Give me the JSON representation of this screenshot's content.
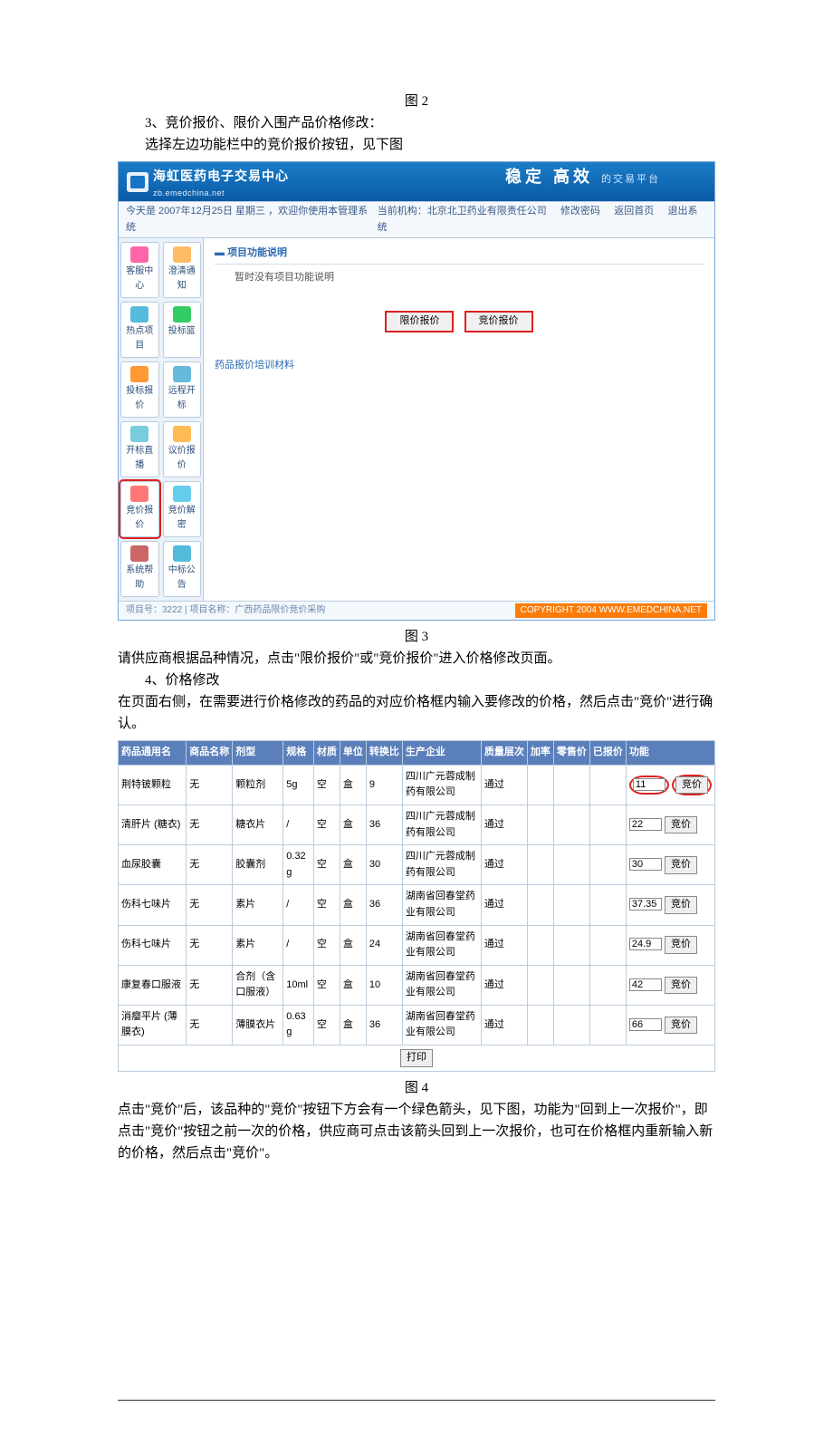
{
  "figs": {
    "f2": "图 2",
    "f3": "图 3",
    "f4": "图 4"
  },
  "text": {
    "sec3": "3、竞价报价、限价入围产品价格修改：",
    "sec3b": "选择左边功能栏中的竞价报价按钮，见下图",
    "between": "请供应商根据品种情况，点击\"限价报价\"或\"竞价报价\"进入价格修改页面。",
    "sec4": "4、价格修改",
    "sec4a": "在页面右侧，在需要进行价格修改的药品的对应价格框内输入要修改的价格，然后点击\"竞价\"进行确认。",
    "after": "点击\"竞价\"后，该品种的\"竞价\"按钮下方会有一个绿色箭头，见下图，功能为\"回到上一次报价\"，即点击\"竞价\"按钮之前一次的价格，供应商可点击该箭头回到上一次报价，也可在价格框内重新输入新的价格，然后点击\"竞价\"。"
  },
  "app": {
    "brand": "海虹医药电子交易中心",
    "brand_sub": "zb.emedchina.net",
    "banner": "稳定 高效",
    "banner_sub": "的交易平台",
    "date_line": "今天是 2007年12月25日 星期三 ，欢迎你使用本管理系统",
    "org": "当前机构：北京北卫药业有限责任公司",
    "links": {
      "pwd": "修改密码",
      "home": "返回首页",
      "logout": "退出系统"
    },
    "sidebar": [
      "客服中心",
      "澄清通知",
      "热点项目",
      "投标篮",
      "投标报价",
      "远程开标",
      "开标直播",
      "议价报价",
      "竞价报价",
      "竞价解密",
      "系统帮助",
      "中标公告"
    ],
    "panel": {
      "head": "项目功能说明",
      "empty": "暂时没有项目功能说明",
      "btn_limit": "限价报价",
      "btn_bid": "竞价报价",
      "link": "药品报价培训材料"
    },
    "footer": {
      "l": "项目号：3222 | 项目名称：广西药品限价竞价采购",
      "r": "COPYRIGHT 2004 WWW.EMEDCHINA.NET"
    }
  },
  "table": {
    "headers": [
      "药品通用名",
      "商品名称",
      "剂型",
      "规格",
      "材质",
      "单位",
      "转换比",
      "生产企业",
      "质量层次",
      "加率",
      "零售价",
      "已报价",
      "功能"
    ],
    "rows": [
      {
        "c": [
          "荆特铍颗粒",
          "无",
          "颗粒剂",
          "5g",
          "空",
          "盒",
          "9",
          "四川广元蓉成制药有限公司",
          "通过",
          "",
          "",
          ""
        ],
        "price": "11"
      },
      {
        "c": [
          "清肝片 (糖衣)",
          "无",
          "糖衣片",
          "/",
          "空",
          "盒",
          "36",
          "四川广元蓉成制药有限公司",
          "通过",
          "",
          "",
          ""
        ],
        "price": "22"
      },
      {
        "c": [
          "血尿胶囊",
          "无",
          "胶囊剂",
          "0.32 g",
          "空",
          "盒",
          "30",
          "四川广元蓉成制药有限公司",
          "通过",
          "",
          "",
          ""
        ],
        "price": "30"
      },
      {
        "c": [
          "伤科七味片",
          "无",
          "素片",
          "/",
          "空",
          "盒",
          "36",
          "湖南省回春堂药业有限公司",
          "通过",
          "",
          "",
          ""
        ],
        "price": "37.35"
      },
      {
        "c": [
          "伤科七味片",
          "无",
          "素片",
          "/",
          "空",
          "盒",
          "24",
          "湖南省回春堂药业有限公司",
          "通过",
          "",
          "",
          ""
        ],
        "price": "24.9"
      },
      {
        "c": [
          "康复春口服液",
          "无",
          "合剂（含口服液）",
          "10ml",
          "空",
          "盒",
          "10",
          "湖南省回春堂药业有限公司",
          "通过",
          "",
          "",
          ""
        ],
        "price": "42"
      },
      {
        "c": [
          "消瘿平片 (薄膜衣)",
          "无",
          "薄膜衣片",
          "0.63 g",
          "空",
          "盒",
          "36",
          "湖南省回春堂药业有限公司",
          "通过",
          "",
          "",
          ""
        ],
        "price": "66"
      }
    ],
    "bid_label": "竞价",
    "print": "打印"
  }
}
